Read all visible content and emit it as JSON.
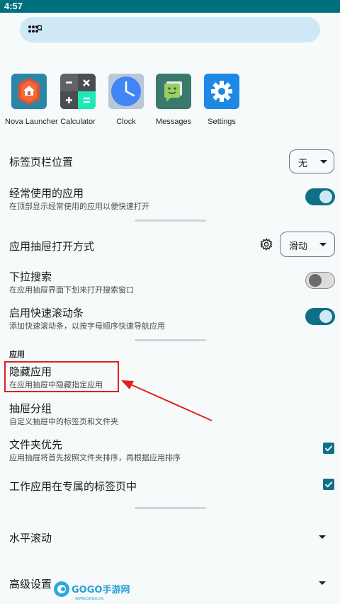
{
  "status_bar": {
    "time": "4:57"
  },
  "apps": [
    {
      "label": "Nova Launcher",
      "icon": "nova-launcher-icon"
    },
    {
      "label": "Calculator",
      "icon": "calculator-icon"
    },
    {
      "label": "Clock",
      "icon": "clock-icon"
    },
    {
      "label": "Messages",
      "icon": "messages-icon"
    },
    {
      "label": "Settings",
      "icon": "settings-gear-icon"
    }
  ],
  "settings": {
    "tab_bar_position": {
      "title": "标签页栏位置",
      "value": "无"
    },
    "frequent_apps": {
      "title": "经常使用的应用",
      "subtitle": "在顶部显示经常使用的应用以便快速打开",
      "enabled": true
    },
    "drawer_open_style": {
      "title": "应用抽屉打开方式",
      "value": "滑动"
    },
    "pull_down_search": {
      "title": "下拉搜索",
      "subtitle": "在应用抽屉界面下划来打开搜索窗口",
      "enabled": false
    },
    "fast_scrollbar": {
      "title": "启用快速滚动条",
      "subtitle": "添加快速滚动条，以按字母顺序快速导航应用",
      "enabled": true
    },
    "section_apps": "应用",
    "hide_apps": {
      "title": "隐藏应用",
      "subtitle": "在应用抽屉中隐藏指定应用"
    },
    "drawer_groups": {
      "title": "抽屉分组",
      "subtitle": "自定义抽屉中的标签页和文件夹"
    },
    "folders_first": {
      "title": "文件夹优先",
      "subtitle": "应用抽屉将首先按照文件夹排序，再根据应用排序",
      "checked": true
    },
    "work_apps_tab": {
      "title": "工作应用在专属的标签页中",
      "checked": true
    },
    "horizontal_scroll": {
      "title": "水平滚动"
    },
    "advanced": {
      "title": "高级设置"
    }
  },
  "watermark": {
    "text": "GOGO手游网",
    "sub": "WWW.GOGO.CN"
  },
  "colors": {
    "accent": "#0f6f86",
    "status_bar": "#00707f",
    "annotation": "#e02020"
  }
}
